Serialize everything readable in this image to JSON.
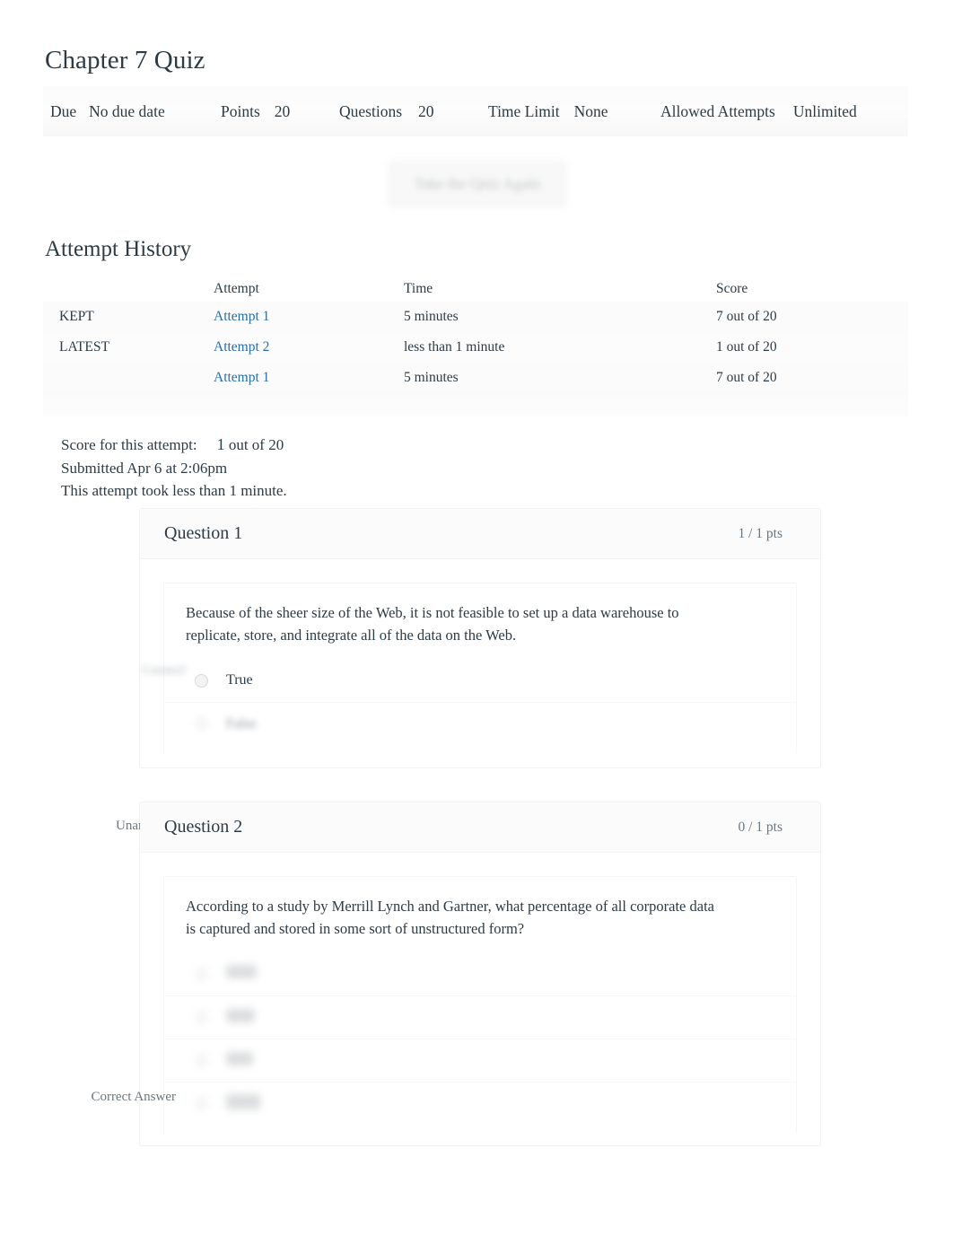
{
  "quiz": {
    "title": "Chapter 7 Quiz"
  },
  "meta": {
    "due_label": "Due",
    "due_value": "No due date",
    "points_label": "Points",
    "points_value": "20",
    "questions_label": "Questions",
    "questions_value": "20",
    "time_limit_label": "Time Limit",
    "time_limit_value": "None",
    "attempts_label": "Allowed Attempts",
    "attempts_value": "Unlimited"
  },
  "actions": {
    "retake_label": "Take the Quiz Again"
  },
  "attempt_history": {
    "heading": "Attempt History",
    "columns": [
      "",
      "Attempt",
      "Time",
      "Score"
    ],
    "rows": [
      {
        "tag": "KEPT",
        "attempt": "Attempt 1",
        "time": "5 minutes",
        "score": "7 out of 20"
      },
      {
        "tag": "LATEST",
        "attempt": "Attempt 2",
        "time": "less than 1 minute",
        "score": "1 out of 20"
      },
      {
        "tag": "",
        "attempt": "Attempt 1",
        "time": "5 minutes",
        "score": "7 out of 20"
      }
    ]
  },
  "summary": {
    "score_label": "Score for this attempt:",
    "score_value": "1",
    "score_suffix": "out of 20",
    "submitted": "Submitted Apr 6 at 2:06pm",
    "duration": "This attempt took less than 1 minute."
  },
  "questions": [
    {
      "name": "Question 1",
      "points": "1 / 1 pts",
      "status_label": "Correct!",
      "status_blurred": true,
      "text": "Because of the sheer size of the Web, it is not feasible to set up a data warehouse to replicate, store, and integrate all of the data on the Web.",
      "answers": [
        {
          "text": "True",
          "blurred": false
        },
        {
          "text": "False",
          "blurred": true
        }
      ]
    },
    {
      "name": "Question 2",
      "points": "0 / 1 pts",
      "status_label": "Unanswered",
      "status_blurred": false,
      "correct_answer_label": "Correct Answer",
      "text": "According to a study by Merrill Lynch and Gartner, what percentage of all corporate data is captured and stored in some sort of unstructured form?",
      "answers": [
        {
          "text": "",
          "blurred": true
        },
        {
          "text": "",
          "blurred": true
        },
        {
          "text": "",
          "blurred": true
        },
        {
          "text": "",
          "blurred": true
        }
      ]
    }
  ],
  "colors": {
    "link": "#2b6ca3",
    "text": "#2d3b45",
    "muted": "#6b7780",
    "border": "#f1f2f3"
  }
}
